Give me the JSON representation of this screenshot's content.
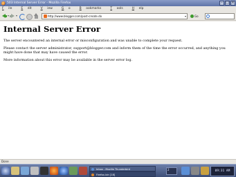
{
  "window": {
    "title": "503 Internal Server Error - Mozilla Firefox"
  },
  "menu": {
    "items": [
      {
        "label": "File",
        "accel": "F",
        "rest": "ile"
      },
      {
        "label": "Edit",
        "accel": "E",
        "rest": "dit"
      },
      {
        "label": "View",
        "accel": "V",
        "rest": "iew"
      },
      {
        "label": "Go",
        "accel": "G",
        "rest": "o"
      },
      {
        "label": "Bookmarks",
        "accel": "B",
        "rest": "ookmarks"
      },
      {
        "label": "Tools",
        "accel": "T",
        "rest": "ools"
      },
      {
        "label": "Help",
        "accel": "H",
        "rest": "elp"
      }
    ]
  },
  "toolbar": {
    "url": "http://www.blogger.com/post-create.do",
    "go_label": "Go",
    "icons": {
      "back": "back-arrow-icon",
      "forward": "forward-arrow-icon",
      "reload": "reload-icon",
      "stop": "stop-icon",
      "home": "home-icon",
      "search_engine": "google-search-icon"
    }
  },
  "page": {
    "heading": "Internal Server Error",
    "paragraphs": [
      "The server encountered an internal error or misconfiguration and was unable to complete your request.",
      "Please contact the server administrator, support@blogger.com and inform them of the time the error occurred, and anything you might have done that may have caused the error.",
      "More information about this error may be available in the server error log."
    ]
  },
  "status": {
    "text": "Done"
  },
  "taskbar": {
    "tasks": [
      {
        "label": "Inbox - Mozilla Thunderbird",
        "dot_color": "#5b8fd6"
      },
      {
        "label": "Firefox-bin [18]",
        "dot_color": "#e0892c"
      }
    ],
    "pager_num": "2",
    "clock": "09:31 AM"
  },
  "colors": {
    "titlebar": "#6a80b4",
    "taskbar": "#4e6088",
    "page_bg": "#ffffff",
    "chrome_bg": "#e8e6e1"
  }
}
